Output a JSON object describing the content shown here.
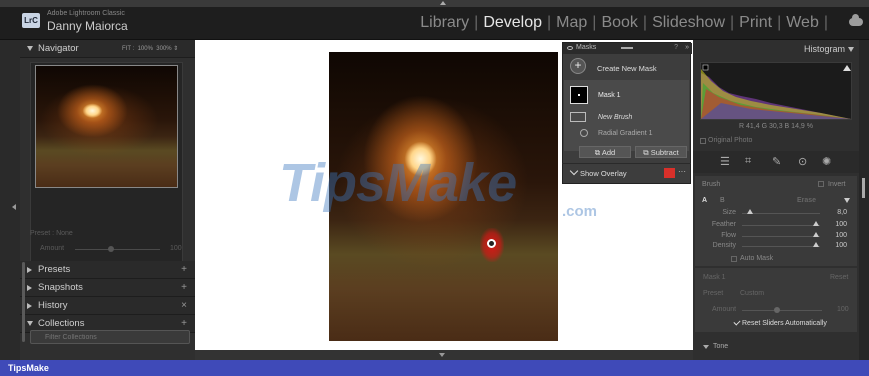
{
  "titlebar": {
    "app_name": "Adobe Lightroom Classic",
    "user": "Danny Maiorca",
    "logo": "LrC"
  },
  "modules": [
    "Library",
    "Develop",
    "Map",
    "Book",
    "Slideshow",
    "Print",
    "Web"
  ],
  "active_module": "Develop",
  "left_panel": {
    "navigator": {
      "title": "Navigator",
      "zoom_options": [
        "FIT :",
        "100%",
        "300%"
      ]
    },
    "preset_label": "Preset : None",
    "amount_label": "Amount",
    "amount_value": "100",
    "sections": [
      {
        "label": "Presets",
        "action": "+"
      },
      {
        "label": "Snapshots",
        "action": "+"
      },
      {
        "label": "History",
        "action": "×"
      },
      {
        "label": "Collections",
        "action": "+"
      }
    ],
    "collections_filter_placeholder": "Filter Collections"
  },
  "masks_panel": {
    "title": "Masks",
    "help": "?",
    "expand": "»",
    "create_new": "Create New Mask",
    "mask_name": "Mask 1",
    "components": [
      "New Brush",
      "Radial Gradient 1"
    ],
    "add": "Add",
    "subtract": "Subtract",
    "show_overlay": "Show Overlay",
    "overlay_color": "#d9302a",
    "more": "···"
  },
  "right_panel": {
    "histogram_title": "Histogram",
    "rgb_readout": "R 41,4 G 30,3 B 14,9 %",
    "original_photo": "Original Photo",
    "brush": {
      "title": "Brush",
      "invert": "Invert",
      "tabs": [
        "A",
        "B"
      ],
      "erase": "Erase",
      "sliders": [
        {
          "label": "Size",
          "value": "8,0",
          "level": 0.07
        },
        {
          "label": "Feather",
          "value": "100",
          "level": 1.0
        },
        {
          "label": "Flow",
          "value": "100",
          "level": 1.0
        },
        {
          "label": "Density",
          "value": "100",
          "level": 1.0
        }
      ],
      "auto_mask": "Auto Mask"
    },
    "adjust": {
      "mask_label": "Mask 1",
      "reset": "Reset",
      "preset_label": "Preset",
      "preset_value": "Custom",
      "amount_label": "Amount",
      "amount_value": "100",
      "reset_sliders": "Reset Sliders Automatically"
    },
    "tone_label": "Tone"
  },
  "watermark": {
    "text": "TipsMake",
    "suffix": ".com"
  },
  "footer": {
    "brand": "TipsMake"
  }
}
